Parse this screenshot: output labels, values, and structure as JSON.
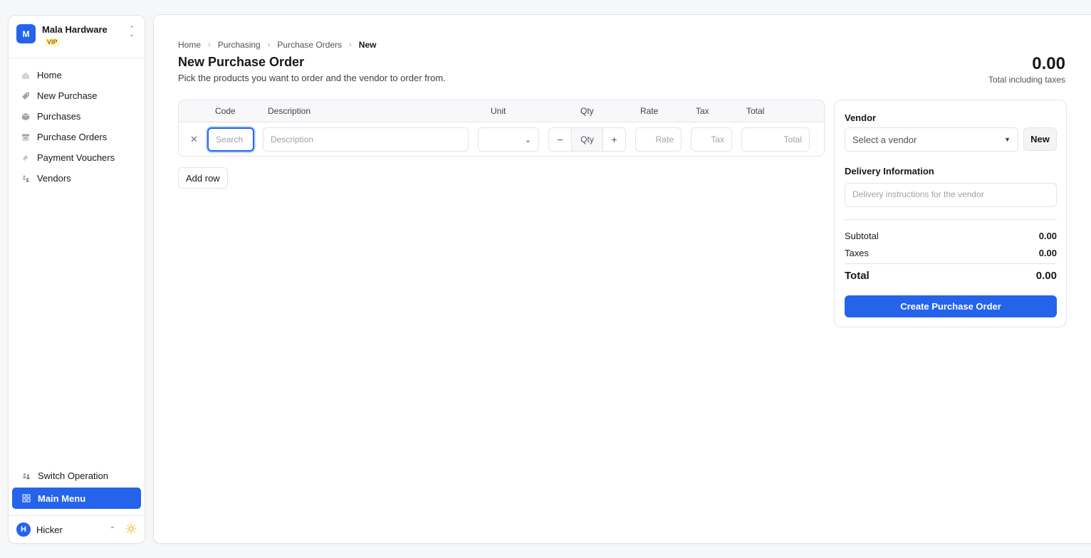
{
  "org": {
    "avatar_letter": "M",
    "name": "Mala Hardware",
    "badge": "VIP"
  },
  "nav": {
    "items": [
      {
        "label": "Home",
        "icon": "house-icon"
      },
      {
        "label": "New Purchase",
        "icon": "tag-icon"
      },
      {
        "label": "Purchases",
        "icon": "box-icon"
      },
      {
        "label": "Purchase Orders",
        "icon": "archive-icon"
      },
      {
        "label": "Payment Vouchers",
        "icon": "ticket-icon"
      },
      {
        "label": "Vendors",
        "icon": "users-icon"
      }
    ],
    "switch_operation": "Switch Operation",
    "main_menu": "Main Menu"
  },
  "user": {
    "avatar_letter": "H",
    "name": "Hicker"
  },
  "breadcrumb": [
    "Home",
    "Purchasing",
    "Purchase Orders",
    "New"
  ],
  "page": {
    "title": "New Purchase Order",
    "subtitle": "Pick the products you want to order and the vendor to order from.",
    "total_value": "0.00",
    "total_label": "Total including taxes"
  },
  "lines": {
    "headers": {
      "code": "Code",
      "description": "Description",
      "unit": "Unit",
      "qty": "Qty",
      "rate": "Rate",
      "tax": "Tax",
      "total": "Total"
    },
    "row": {
      "code_placeholder": "Search",
      "description_placeholder": "Description",
      "unit_value": "",
      "qty_placeholder": "Qty",
      "rate_placeholder": "Rate",
      "tax_placeholder": "Tax",
      "total_placeholder": "Total"
    },
    "add_row": "Add row"
  },
  "vendor": {
    "label": "Vendor",
    "select_placeholder": "Select a vendor",
    "new_button": "New",
    "delivery_label": "Delivery Information",
    "delivery_placeholder": "Delivery instructions for the vendor",
    "subtotal_label": "Subtotal",
    "subtotal_value": "0.00",
    "taxes_label": "Taxes",
    "taxes_value": "0.00",
    "total_label": "Total",
    "total_value": "0.00",
    "create_button": "Create Purchase Order"
  },
  "colors": {
    "accent": "#2563eb",
    "badge_bg": "#fef9c3",
    "badge_text": "#a16207",
    "sun": "#eab308"
  }
}
